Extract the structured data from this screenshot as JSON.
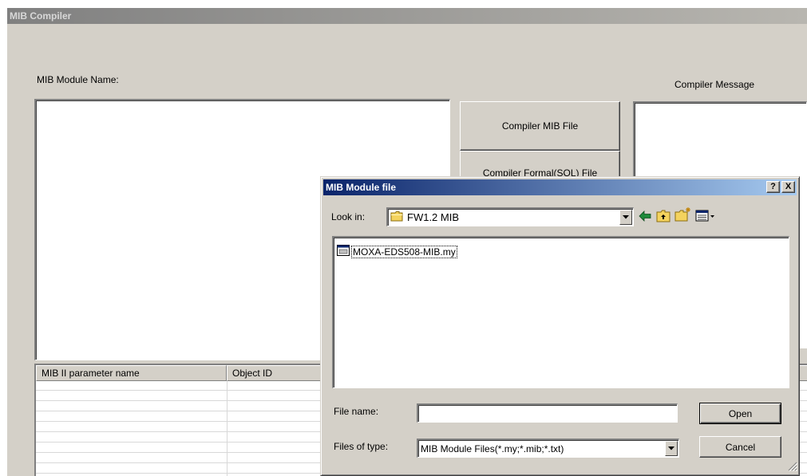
{
  "main_window": {
    "title": "MIB Compiler",
    "module_name_label": "MIB Module Name:",
    "compiler_message_label": "Compiler Message",
    "compile_button": "Compiler MIB File",
    "second_button_partial": "Compiler Formal(SQL) File",
    "table": {
      "columns": [
        "MIB II parameter name",
        "Object ID"
      ]
    }
  },
  "dialog": {
    "title": "MIB Module file",
    "help_button": "?",
    "close_button": "X",
    "look_in_label": "Look in:",
    "look_in_value": "FW1.2 MIB",
    "files": [
      {
        "name": "MOXA-EDS508-MIB.my"
      }
    ],
    "file_name_label": "File name:",
    "file_name_value": "",
    "files_of_type_label": "Files of type:",
    "files_of_type_value": "MIB Module Files(*.my;*.mib;*.txt)",
    "open_button": "Open",
    "cancel_button": "Cancel"
  },
  "icons": {
    "look_in": "folder-icon",
    "back": "back-arrow-icon",
    "up": "up-folder-icon",
    "new_folder": "new-folder-icon",
    "view": "view-menu-icon",
    "file": "mib-file-icon"
  },
  "colors": {
    "dialog_title_start": "#0a246a",
    "dialog_title_end": "#a6caf0",
    "window_face": "#d4d0c8",
    "folder_yellow": "#f4d35e"
  }
}
